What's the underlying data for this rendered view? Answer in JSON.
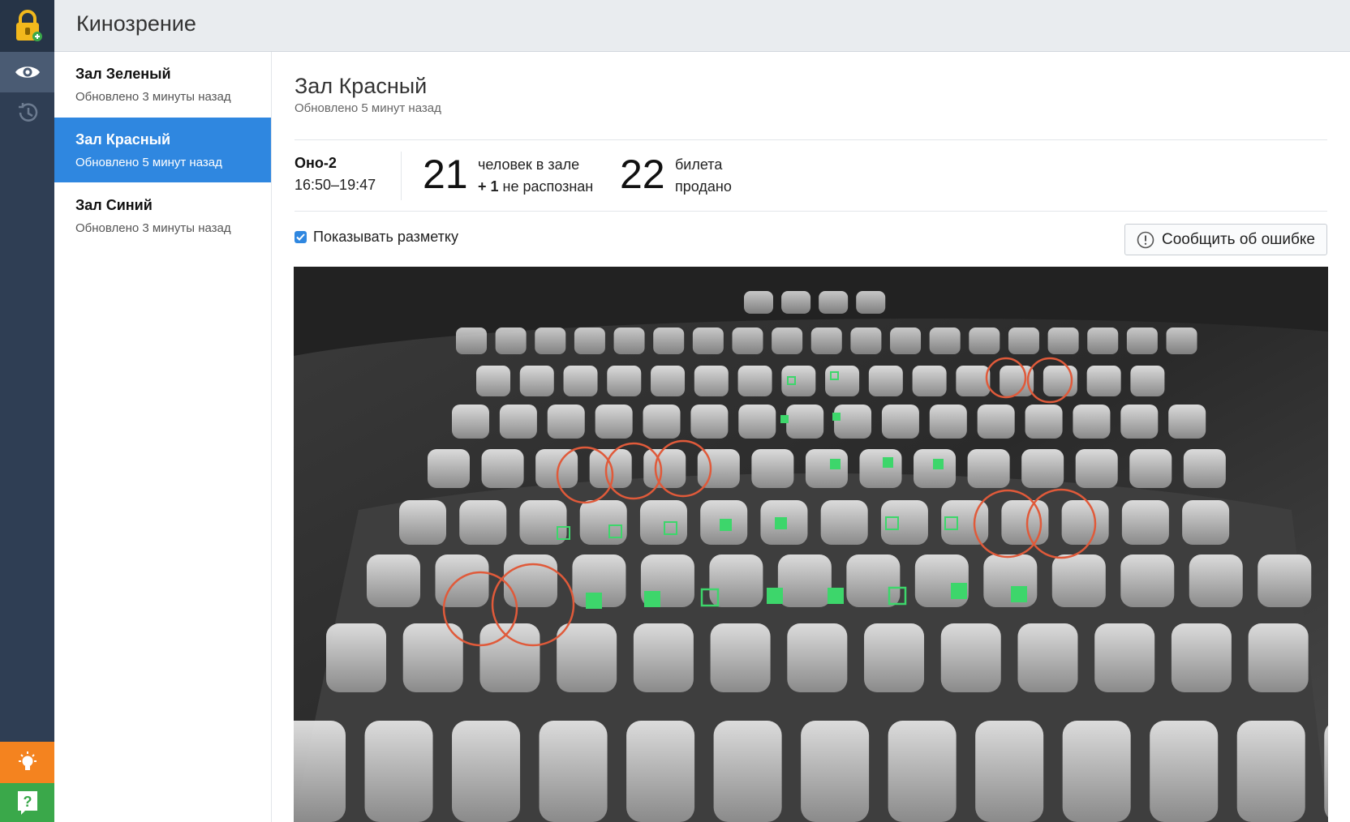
{
  "app": {
    "title": "Кинозрение"
  },
  "rail": {
    "logo_icon": "lock-plus-icon",
    "items": [
      {
        "icon": "eye-icon",
        "active": true
      },
      {
        "icon": "history-icon",
        "active": false
      }
    ],
    "tip_icon": "lightbulb-icon",
    "help_icon": "question-icon"
  },
  "sidebar": {
    "halls": [
      {
        "name": "Зал Зеленый",
        "updated": "Обновлено 3 минуты назад",
        "active": false
      },
      {
        "name": "Зал Красный",
        "updated": "Обновлено 5 минут назад",
        "active": true
      },
      {
        "name": "Зал Синий",
        "updated": "Обновлено 3 минуты назад",
        "active": false
      }
    ]
  },
  "main": {
    "title": "Зал Красный",
    "updated": "Обновлено 5 минут назад",
    "session": {
      "name": "Оно-2",
      "time": "16:50–19:47"
    },
    "people": {
      "count": "21",
      "label": "человек в зале",
      "extra_prefix": "+ 1",
      "extra_label": "не распознан"
    },
    "tickets": {
      "count": "22",
      "label_line1": "билета",
      "label_line2": "продано"
    },
    "markup_toggle": {
      "label": "Показывать разметку",
      "checked": true
    },
    "report_button": {
      "label": "Сообщить об ошибке",
      "icon": "alert-circle-icon"
    }
  },
  "colors": {
    "rail": "#2f3e54",
    "accent": "#2f87e0",
    "tip": "#f4831f",
    "help": "#3aa84a",
    "recognized_marker": "#3dd66b",
    "unrecognized_marker": "#e05a3a"
  }
}
